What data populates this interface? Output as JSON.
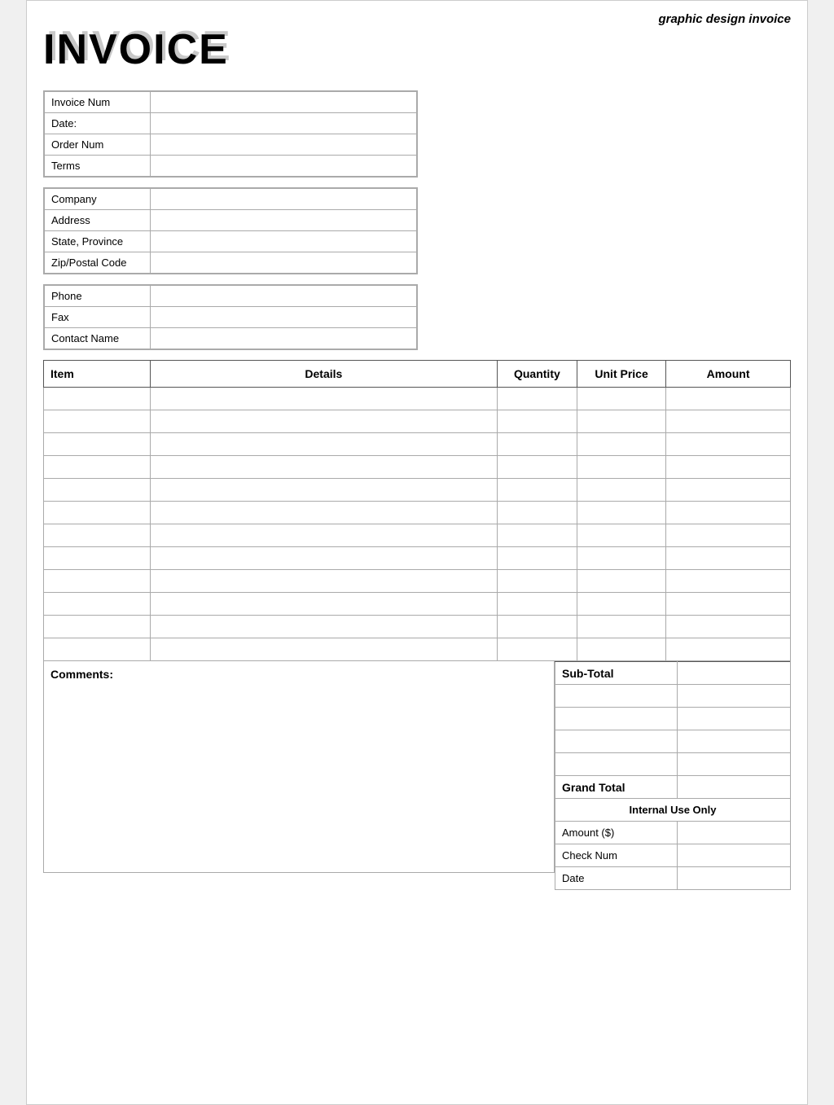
{
  "page": {
    "subtitle": "graphic design invoice",
    "title": "INVOICE",
    "title_shadow": "INVOICE"
  },
  "invoice_info": {
    "fields": [
      {
        "label": "Invoice Num",
        "value": ""
      },
      {
        "label": "Date:",
        "value": ""
      },
      {
        "label": "Order Num",
        "value": ""
      },
      {
        "label": "Terms",
        "value": ""
      }
    ]
  },
  "company_info": {
    "fields": [
      {
        "label": "Company",
        "value": ""
      },
      {
        "label": "Address",
        "value": ""
      },
      {
        "label": "State, Province",
        "value": ""
      },
      {
        "label": "Zip/Postal Code",
        "value": ""
      }
    ]
  },
  "contact_info": {
    "fields": [
      {
        "label": "Phone",
        "value": ""
      },
      {
        "label": "Fax",
        "value": ""
      },
      {
        "label": "Contact Name",
        "value": ""
      }
    ]
  },
  "items_table": {
    "headers": [
      "Item",
      "Details",
      "Quantity",
      "Unit Price",
      "Amount"
    ],
    "rows": 12
  },
  "comments": {
    "label": "Comments:"
  },
  "totals": {
    "subtotal_label": "Sub-Total",
    "extra_rows": 4,
    "grand_total_label": "Grand Total",
    "internal_use_label": "Internal Use Only",
    "internal_fields": [
      {
        "label": "Amount ($)",
        "value": ""
      },
      {
        "label": "Check Num",
        "value": ""
      },
      {
        "label": "Date",
        "value": ""
      }
    ]
  }
}
